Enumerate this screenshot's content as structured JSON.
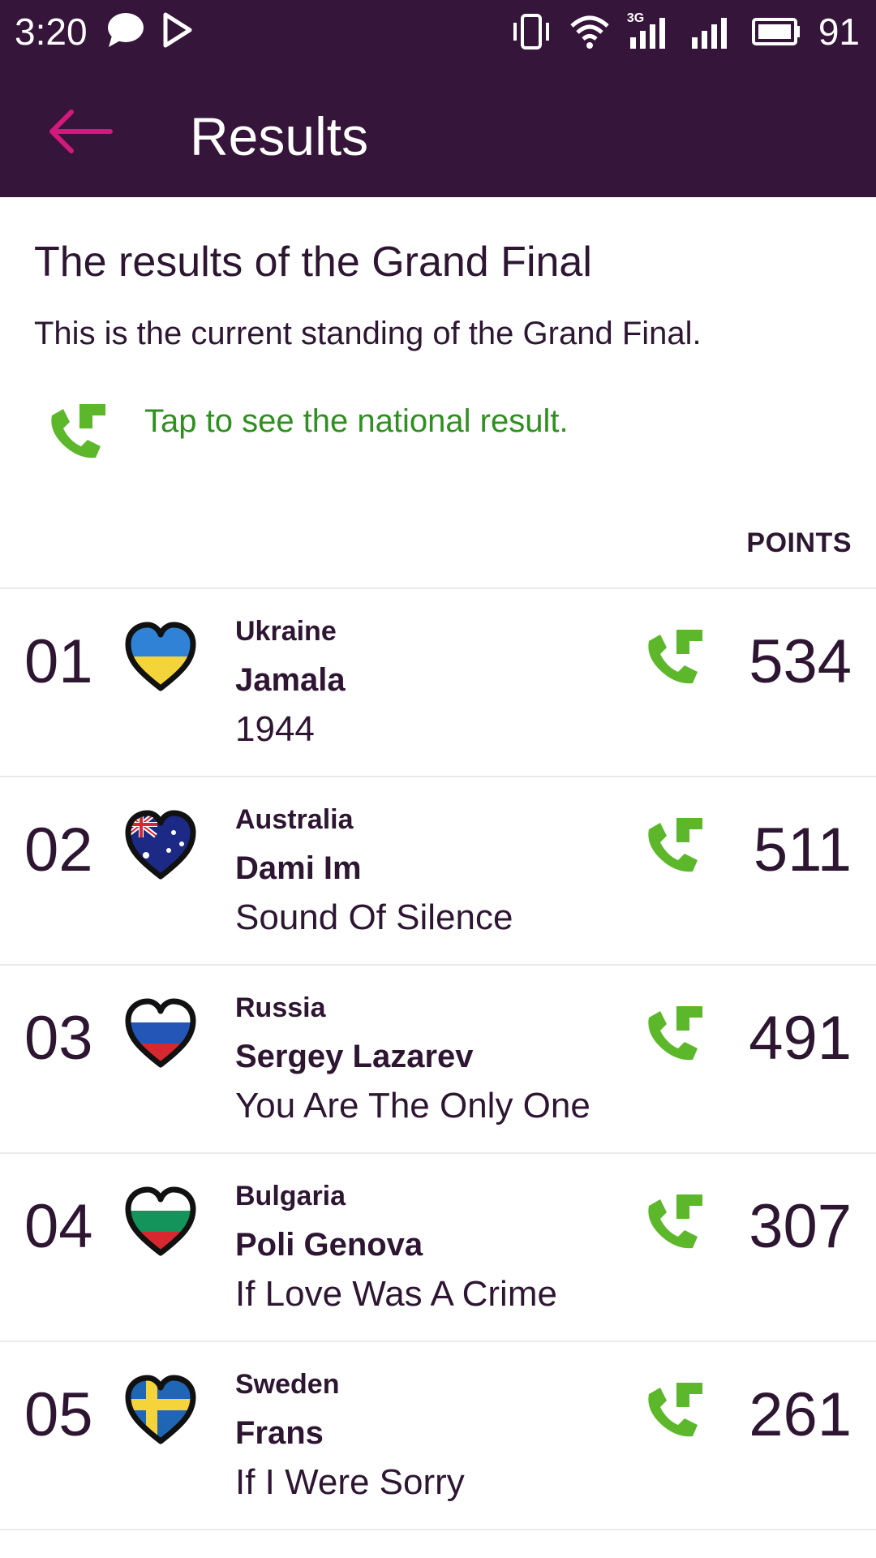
{
  "status_bar": {
    "time": "3:20",
    "network_label": "3G",
    "battery": "91"
  },
  "app_bar": {
    "title": "Results"
  },
  "intro": {
    "title": "The results of the Grand Final",
    "subtitle": "This is the current standing of the Grand Final.",
    "hint": "Tap to see the national result."
  },
  "list": {
    "points_header": "POINTS",
    "rows": [
      {
        "rank": "01",
        "country": "Ukraine",
        "artist": "Jamala",
        "song": "1944",
        "points": "534"
      },
      {
        "rank": "02",
        "country": "Australia",
        "artist": "Dami Im",
        "song": "Sound Of Silence",
        "points": "511"
      },
      {
        "rank": "03",
        "country": "Russia",
        "artist": "Sergey Lazarev",
        "song": "You Are The Only One",
        "points": "491"
      },
      {
        "rank": "04",
        "country": "Bulgaria",
        "artist": "Poli Genova",
        "song": "If Love Was A Crime",
        "points": "307"
      },
      {
        "rank": "05",
        "country": "Sweden",
        "artist": "Frans",
        "song": "If I Were Sorry",
        "points": "261"
      }
    ]
  },
  "colors": {
    "header_bg": "#35153a",
    "accent_back": "#d3197c",
    "phone_icon": "#5cb82a",
    "hint_text": "#2f8f20"
  },
  "icons": {
    "back": "arrow-left-icon",
    "phone": "phone-callback-icon",
    "flag": "heart-flag-icon"
  }
}
